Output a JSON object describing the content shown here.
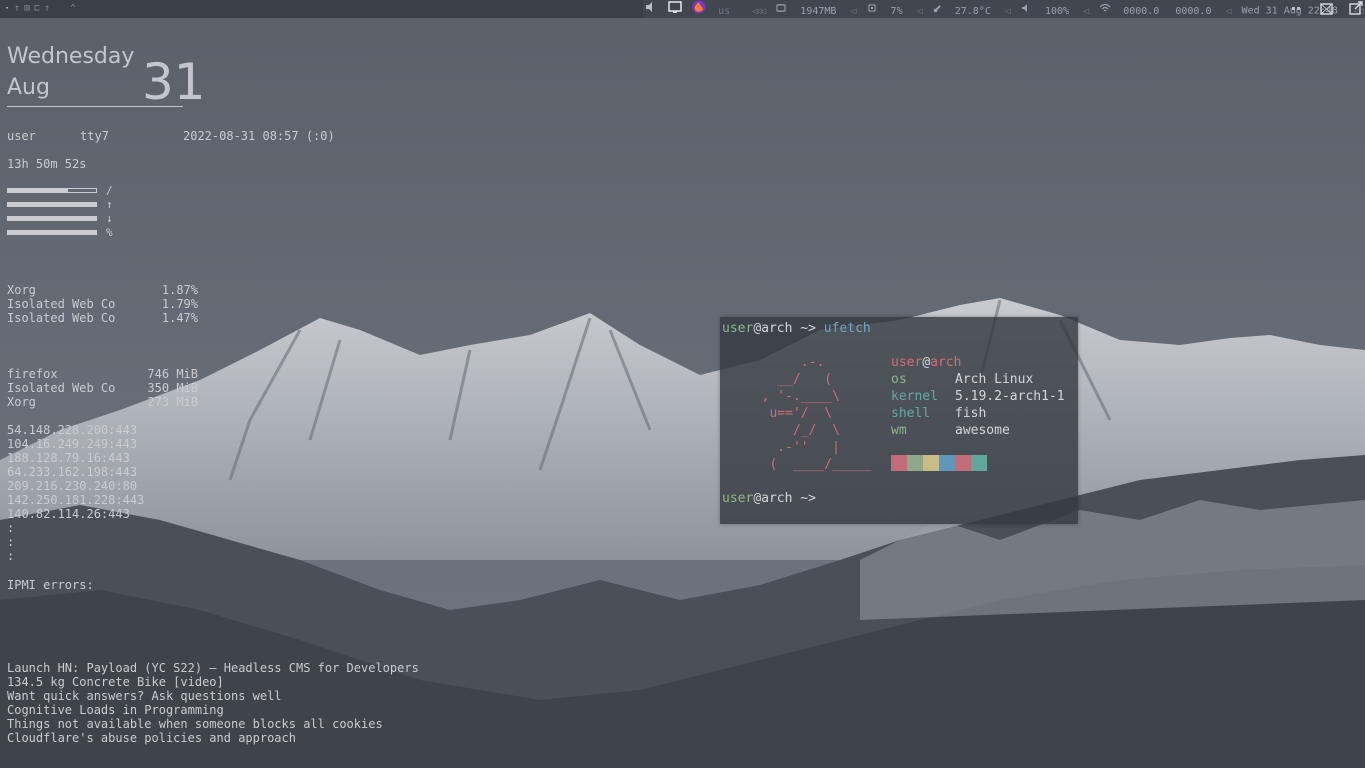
{
  "topbar": {
    "tags": [
      "·",
      "↑",
      "⊠",
      "⊏",
      "↑"
    ],
    "layout_glyph": "⌃",
    "keyboard_layout": "us",
    "memory": "1947MB",
    "cpu": "7%",
    "temperature": "27.8°C",
    "volume": "100%",
    "net_down": "0000.0",
    "net_up": "0000.0",
    "clock": "Wed 31 Aug 22:48",
    "icons": [
      "speaker-icon",
      "screen-icon",
      "firefox-icon",
      "memory-icon",
      "cpu-icon",
      "thermometer-icon",
      "volume-icon",
      "wifi-icon",
      "grid-icon",
      "window-icon",
      "exit-icon"
    ]
  },
  "conky": {
    "date": {
      "dayname": "Wednesday",
      "month": "Aug",
      "day": "31"
    },
    "session": {
      "user": "user",
      "tty": "tty7",
      "login": "2022-08-31 08:57 (:0)"
    },
    "uptime": "13h 50m 52s",
    "bars": [
      {
        "label": "/",
        "level": 0.68
      },
      {
        "label": "↑",
        "level": 1.0
      },
      {
        "label": "↓",
        "level": 1.0
      },
      {
        "label": "%",
        "level": 1.0
      }
    ],
    "top_cpu": [
      {
        "name": "Xorg",
        "value": "1.87%"
      },
      {
        "name": "Isolated Web Co",
        "value": "1.79%"
      },
      {
        "name": "Isolated Web Co",
        "value": "1.47%"
      }
    ],
    "top_mem": [
      {
        "name": "firefox",
        "value": "746 MiB"
      },
      {
        "name": "Isolated Web Co",
        "value": "350 MiB"
      },
      {
        "name": "Xorg",
        "value": "273 MiB"
      }
    ],
    "connections": [
      "54.148.228.200:443",
      "104.16.249.249:443",
      "188.128.79.16:443",
      "64.233.162.198:443",
      "209.216.230.240:80",
      "142.250.181.228:443",
      "140.82.114.26:443",
      ":",
      ":",
      ":"
    ],
    "ipmi": "IPMI errors:",
    "news": [
      "Launch HN: Payload (YC S22) – Headless CMS for Developers",
      "134.5 kg Concrete Bike [video]",
      "Want quick answers? Ask questions well",
      "Cognitive Loads in Programming",
      "Things not available when someone blocks all cookies",
      "Cloudflare's abuse policies and approach"
    ]
  },
  "terminal": {
    "prompt_user": "user",
    "prompt_at": "@",
    "prompt_host": "arch",
    "prompt_arrow": " ~> ",
    "command": "ufetch",
    "ascii": [
      "       .-.",
      "    __/   (",
      "  , '-.____\\",
      "   u=='/  \\",
      "      /_/  \\",
      "    .-''   |",
      "   (  ____/_____"
    ],
    "info_user": "user",
    "info_host": "arch",
    "info": [
      {
        "key": "os",
        "value": "Arch Linux"
      },
      {
        "key": "kernel",
        "value": "5.19.2-arch1-1"
      },
      {
        "key": "shell",
        "value": "fish"
      },
      {
        "key": "wm",
        "value": "awesome"
      }
    ],
    "swatches": [
      "#c46b79",
      "#8fa88a",
      "#c9bc86",
      "#5f97b8",
      "#c46b79",
      "#62a59a"
    ]
  }
}
